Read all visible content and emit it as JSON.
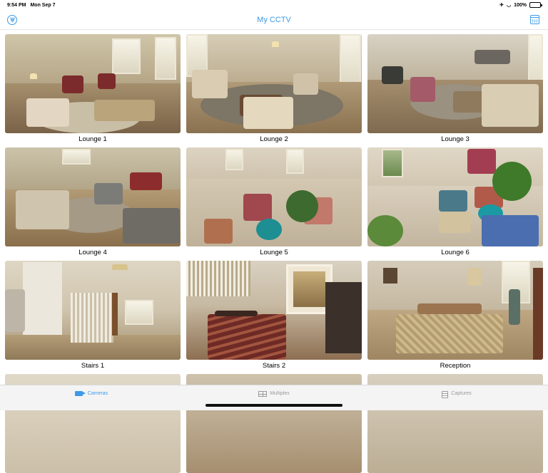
{
  "status_bar": {
    "time": "9:54 PM",
    "date": "Mon Sep 7",
    "battery": "100%"
  },
  "nav": {
    "title": "My CCTV",
    "left_icon": "filter-icon",
    "right_icon": "calendar-icon"
  },
  "accent_color": "#3d9ae8",
  "cameras": [
    {
      "label": "Lounge 1"
    },
    {
      "label": "Lounge 2"
    },
    {
      "label": "Lounge 3"
    },
    {
      "label": "Lounge 4"
    },
    {
      "label": "Lounge 5"
    },
    {
      "label": "Lounge 6"
    },
    {
      "label": "Stairs 1"
    },
    {
      "label": "Stairs 2"
    },
    {
      "label": "Reception"
    }
  ],
  "tabs": [
    {
      "label": "Cameras",
      "icon": "video-camera-icon",
      "active": true
    },
    {
      "label": "Multiplex",
      "icon": "grid-icon",
      "active": false
    },
    {
      "label": "Captures",
      "icon": "list-icon",
      "active": false
    }
  ]
}
